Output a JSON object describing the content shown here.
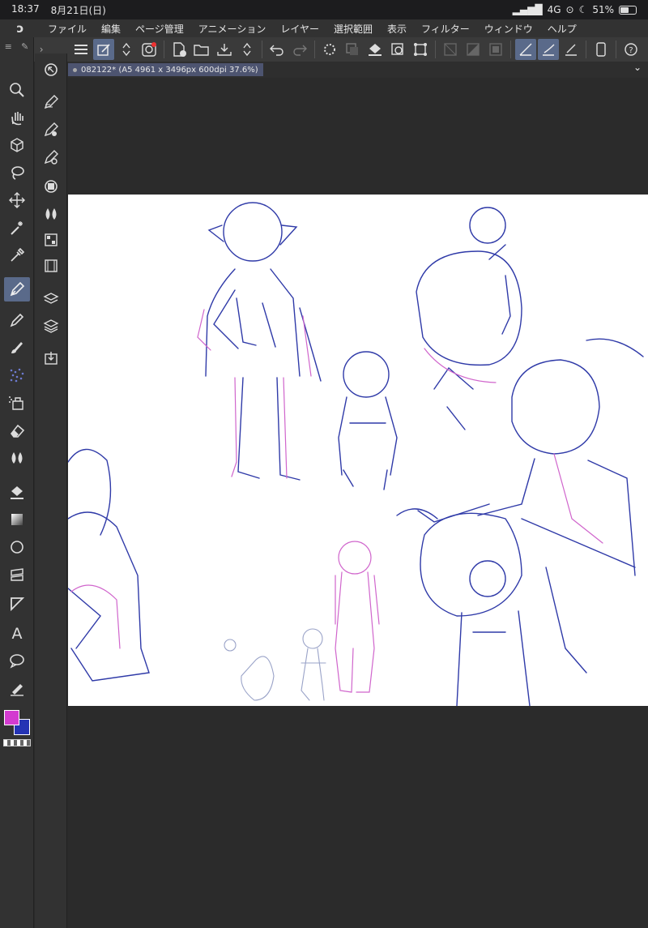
{
  "status": {
    "time": "18:37",
    "date": "8月21日(日)",
    "network": "4G",
    "battery": "51%"
  },
  "menu": {
    "items": [
      "ファイル",
      "編集",
      "ページ管理",
      "アニメーション",
      "レイヤー",
      "選択範囲",
      "表示",
      "フィルター",
      "ウィンドウ",
      "ヘルプ"
    ]
  },
  "document": {
    "tab_label": "082122* (A5 4961 x 3496px 600dpi 37.6%)"
  },
  "colors": {
    "main": "#d33bd0",
    "sub": "#2433b4",
    "canvas_bg": "#ffffff",
    "workspace_bg": "#2b2b2b",
    "active_tool": "#5a6a8a"
  },
  "tools": {
    "left": [
      "zoom-icon",
      "hand-icon",
      "operation-icon",
      "lasso-icon",
      "move-icon",
      "magic-wand-icon",
      "eyedropper-icon",
      "pen-icon",
      "pencil-icon",
      "brush-icon",
      "airbrush-icon",
      "decoration-icon",
      "eraser-icon",
      "blend-icon",
      "fill-icon",
      "gradient-icon",
      "figure-icon",
      "frame-icon",
      "ruler-icon",
      "text-icon",
      "balloon-icon",
      "correction-line-icon"
    ],
    "sub": [
      "back-icon",
      "pen-sub-1-icon",
      "pen-sub-2-icon",
      "pen-sub-3-icon",
      "layer-property-icon",
      "water-icon",
      "pattern-icon",
      "film-icon",
      "layers-icon",
      "layer-stack-icon",
      "import-icon"
    ],
    "active_left": "pen-icon"
  }
}
